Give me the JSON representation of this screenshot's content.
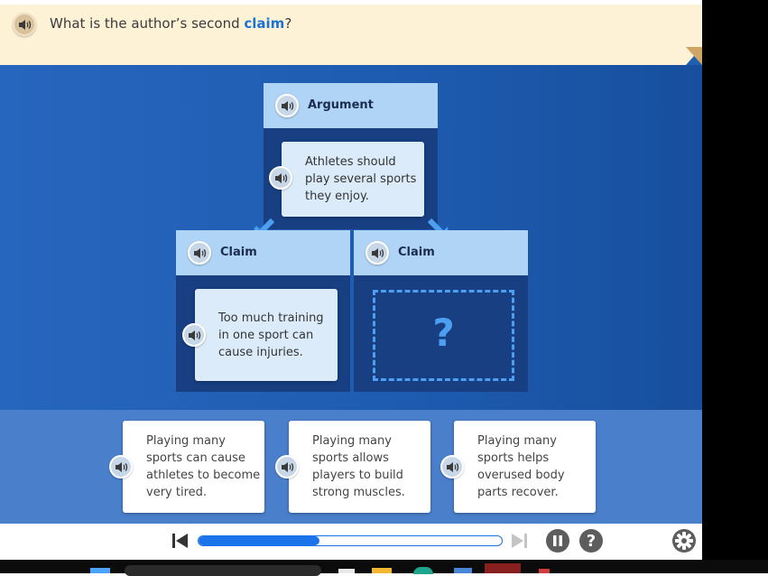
{
  "prompt": {
    "pre": "What is the author’s second ",
    "keyword": "claim",
    "post": "?"
  },
  "argument": {
    "header": "Argument",
    "text": "Athletes should play several sports they enjoy."
  },
  "claims": [
    {
      "header": "Claim",
      "text": "Too much training in one sport can cause injuries."
    },
    {
      "header": "Claim",
      "placeholder": "?"
    }
  ],
  "options": [
    {
      "text": "Playing many\nsports can cause\nathletes to become\nvery tired."
    },
    {
      "text": "Playing many\nsports allows\nplayers to build\nstrong muscles."
    },
    {
      "text": "Playing many\nsports helps\noverused body\nparts recover."
    }
  ],
  "player": {
    "progress": 0.4
  },
  "colors": {
    "accent": "#1b73d4",
    "stage": "#1f5db2",
    "header": "#b0d4f6",
    "dropzone": "#4d9ff2"
  },
  "icons": [
    "speaker-icon",
    "skip-back-icon",
    "skip-forward-icon",
    "pause-icon",
    "help-icon",
    "settings-icon",
    "arrow-icon"
  ]
}
